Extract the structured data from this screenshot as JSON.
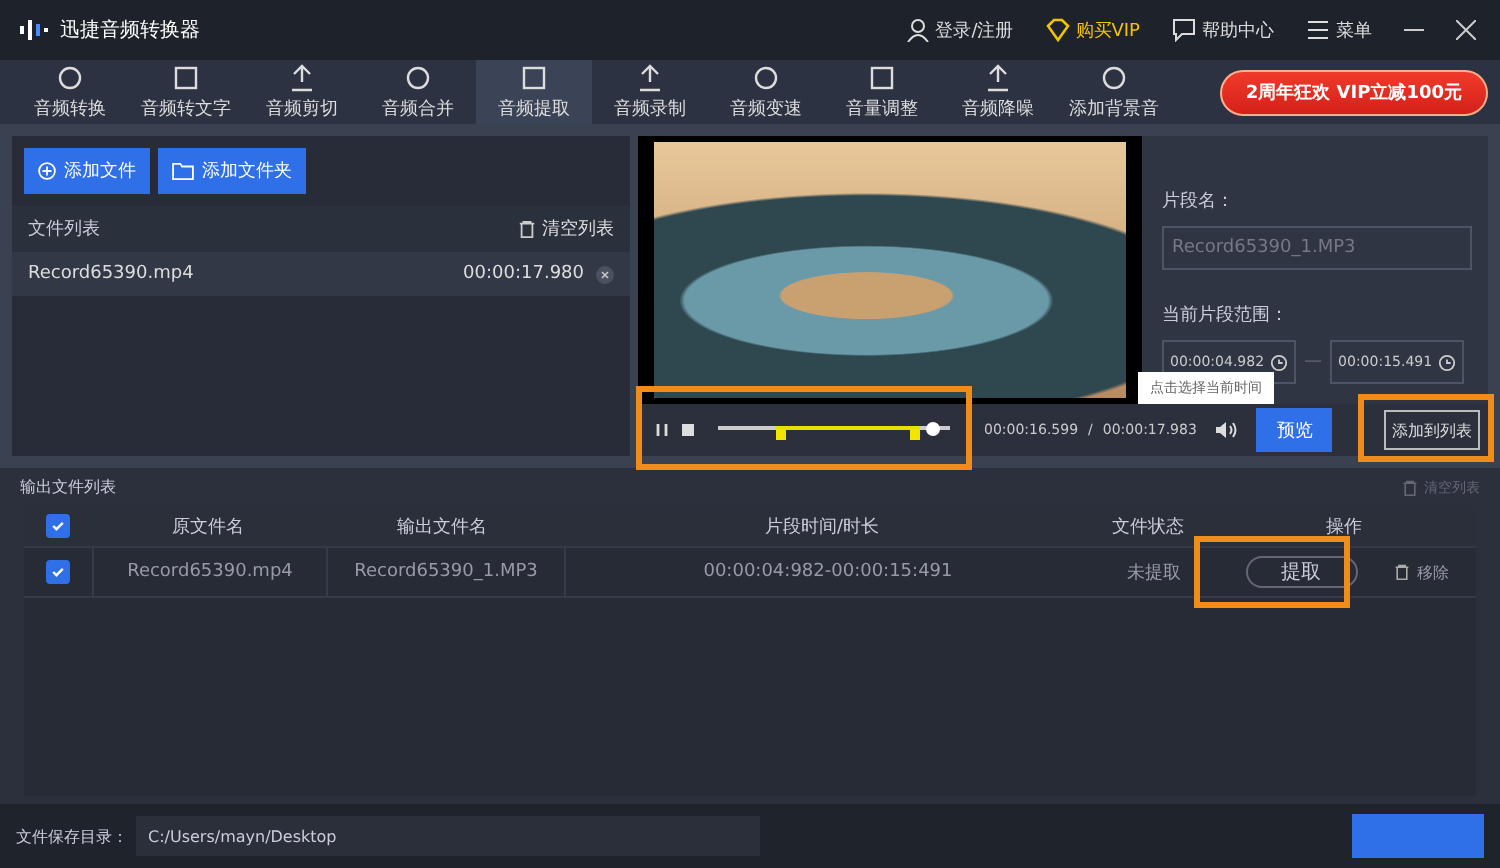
{
  "app": {
    "title": "迅捷音频转换器"
  },
  "header_links": [
    {
      "label": "登录/注册",
      "kind": "user"
    },
    {
      "label": "购买VIP",
      "kind": "vip"
    },
    {
      "label": "帮助中心",
      "kind": "help"
    },
    {
      "label": "菜单",
      "kind": "menu"
    }
  ],
  "tools": [
    {
      "label": "音频转换",
      "selected": false
    },
    {
      "label": "音频转文字",
      "selected": false
    },
    {
      "label": "音频剪切",
      "selected": false
    },
    {
      "label": "音频合并",
      "selected": false
    },
    {
      "label": "音频提取",
      "selected": true
    },
    {
      "label": "音频录制",
      "selected": false
    },
    {
      "label": "音频变速",
      "selected": false
    },
    {
      "label": "音量调整",
      "selected": false
    },
    {
      "label": "音频降噪",
      "selected": false
    },
    {
      "label": "添加背景音",
      "selected": false
    }
  ],
  "promo": "2周年狂欢 VIP立减100元",
  "file_panel": {
    "add_file": "添加文件",
    "add_folder": "添加文件夹",
    "list_title": "文件列表",
    "clear": "清空列表",
    "files": [
      {
        "name": "Record65390.mp4",
        "duration": "00:00:17.980"
      }
    ]
  },
  "player": {
    "current": "00:00:16.599",
    "separator": "/",
    "total": "00:00:17.983",
    "playhead": {
      "level": 0.92
    },
    "selection_start": {
      "level": 0.25
    },
    "selection_end": {
      "level": 0.87
    },
    "preview": "预览",
    "tooltip": "点击选择当前时间"
  },
  "segment": {
    "name_label": "片段名：",
    "name_placeholder": "Record65390_1.MP3",
    "range_label": "当前片段范围：",
    "start": "00:00:04.982",
    "dash": "—",
    "end": "00:00:15.491",
    "add_to_list": "添加到列表"
  },
  "output": {
    "title": "输出文件列表",
    "clear": "清空列表",
    "all_checked": true,
    "columns": [
      "原文件名",
      "输出文件名",
      "片段时间/时长",
      "文件状态",
      "操作"
    ],
    "rows": [
      {
        "checked": true,
        "source": "Record65390.mp4",
        "output": "Record65390_1.MP3",
        "range": "00:00:04:982-00:00:15:491",
        "status": "未提取",
        "action": "提取",
        "remove": "移除"
      }
    ]
  },
  "footer": {
    "label": "文件保存目录：",
    "path": "C:/Users/mayn/Desktop"
  }
}
